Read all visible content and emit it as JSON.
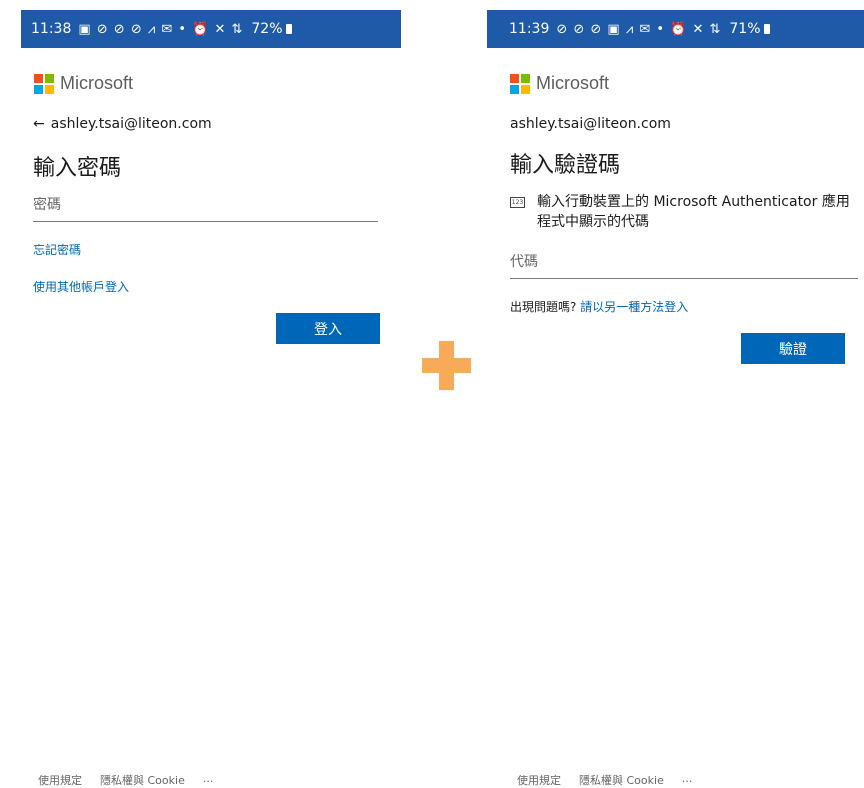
{
  "left": {
    "status": {
      "time": "11:38",
      "icons": "▣ ⊘ ⊘ ⊘ ⩘ ✉ • ⏰ ✕ ⇅",
      "battery": "72%"
    },
    "logo_text": "Microsoft",
    "back_arrow": "←",
    "email": "ashley.tsai@liteon.com",
    "title": "輸入密碼",
    "password_placeholder": "密碼",
    "forgot_link": "忘記密碼",
    "other_account_link": "使用其他帳戶登入",
    "signin_button": "登入",
    "footer": {
      "terms": "使用規定",
      "privacy": "隱私權與 Cookie",
      "more": "..."
    }
  },
  "right": {
    "status": {
      "time": "11:39",
      "icons": "⊘ ⊘ ⊘ ▣ ⩘ ✉ • ⏰ ✕ ⇅",
      "battery": "71%"
    },
    "logo_text": "Microsoft",
    "email": "ashley.tsai@liteon.com",
    "title": "輸入驗證碼",
    "num_icon": "123",
    "instruction": "輸入行動裝置上的 Microsoft Authenticator 應用程式中顯示的代碼",
    "code_placeholder": "代碼",
    "trouble_text": "出現問題嗎?",
    "alt_signin_link": "請以另一種方法登入",
    "verify_button": "驗證",
    "footer": {
      "terms": "使用規定",
      "privacy": "隱私權與 Cookie",
      "more": "..."
    }
  },
  "colors": {
    "accent": "#0067b8",
    "statusbar": "#1f5aa8",
    "plus": "#f7ab5a"
  }
}
